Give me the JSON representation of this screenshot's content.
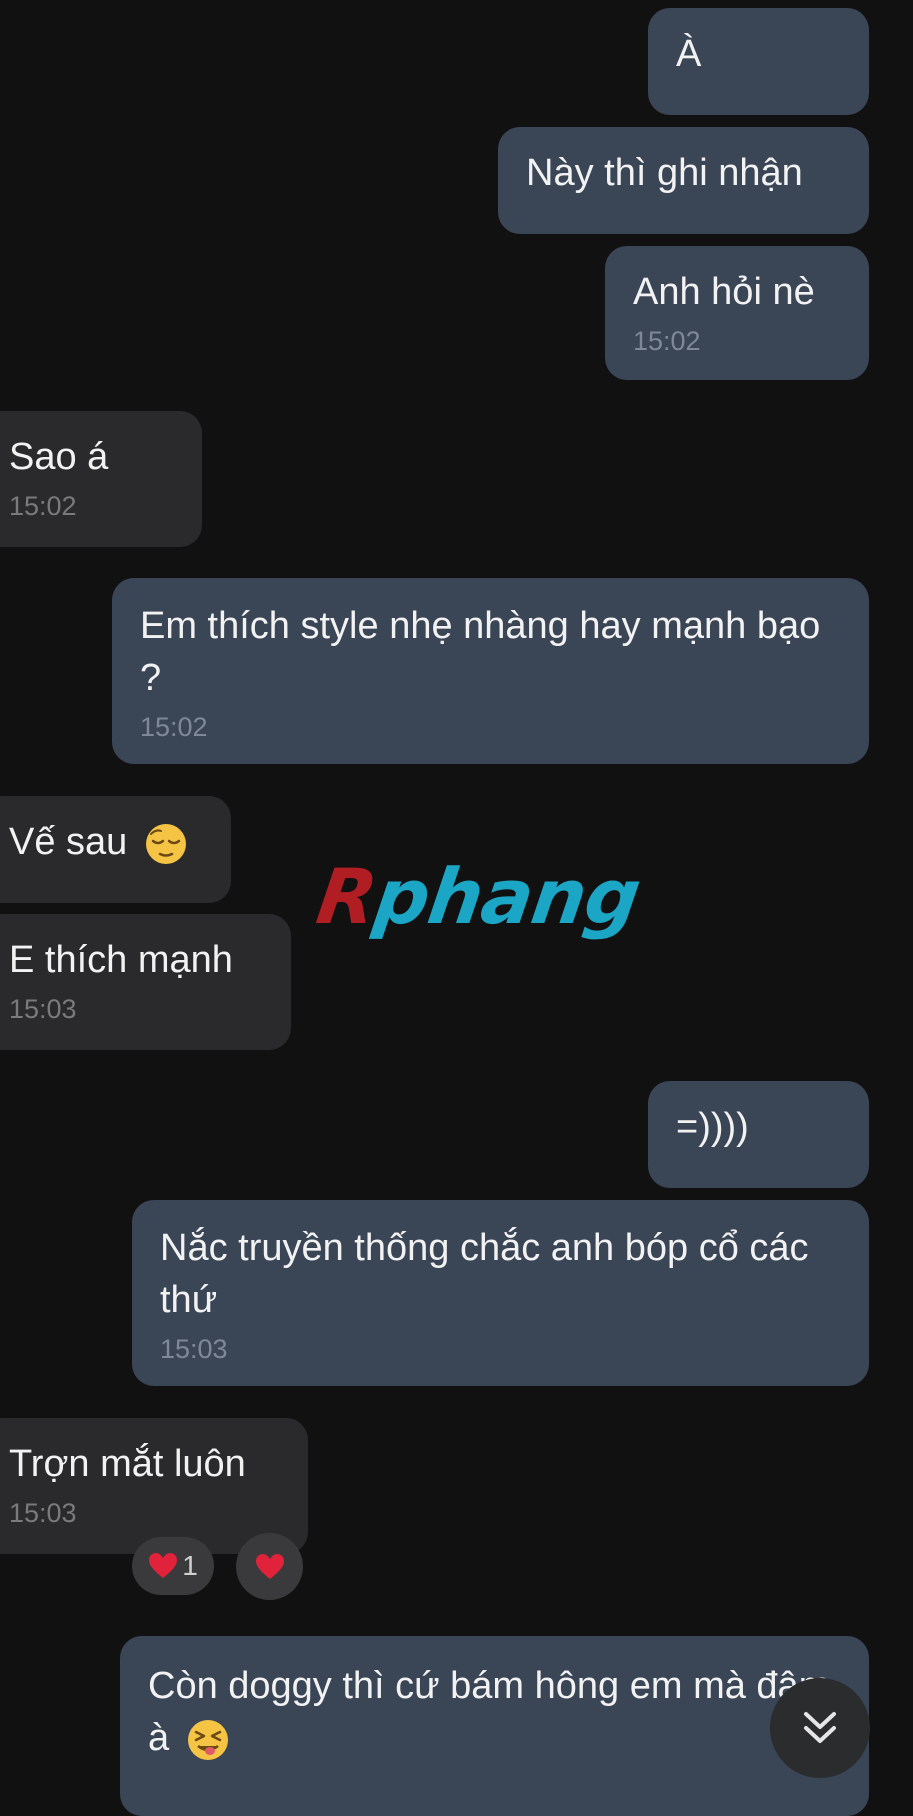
{
  "messages": [
    {
      "text": "À"
    },
    {
      "text": "Này thì ghi nhận"
    },
    {
      "text": "Anh hỏi nè",
      "time": "15:02"
    },
    {
      "text": "Sao á",
      "time": "15:02"
    },
    {
      "text": "Em thích style nhẹ nhàng hay mạnh bạo ?",
      "time": "15:02"
    },
    {
      "text": "Vế sau",
      "emoji": "relieved-face-emoji"
    },
    {
      "text": "E thích mạnh",
      "time": "15:03"
    },
    {
      "text": "=))))"
    },
    {
      "text": "Nắc truyền thống chắc anh bóp cổ các thứ",
      "time": "15:03"
    },
    {
      "text": "Trợn mắt luôn",
      "time": "15:03"
    },
    {
      "text": "Còn doggy thì cứ bám hông em mà đâm à",
      "emoji": "tongue-out-emoji"
    }
  ],
  "reactions": [
    {
      "icon": "heart-icon",
      "count": "1"
    },
    {
      "icon": "heart-icon"
    }
  ],
  "watermark": {
    "first": "R",
    "rest": "phang"
  },
  "scroll_button": {
    "icon": "double-chevron-down-icon"
  },
  "colors": {
    "background": "#111112",
    "sent_bubble": "#3a4556",
    "received_bubble": "#2a2a2c",
    "heart": "#e0223a"
  }
}
